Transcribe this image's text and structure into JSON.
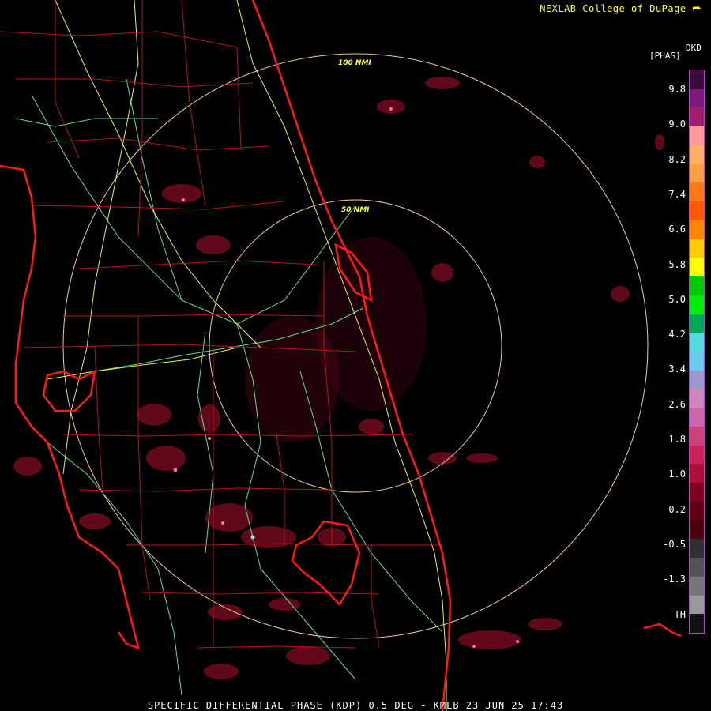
{
  "header": {
    "credit": "NEXLAB-College of DuPage"
  },
  "footer": {
    "caption": "SPECIFIC DIFFERENTIAL PHASE (KDP) 0.5 DEG - KMLB 23 JUN 25 17:43"
  },
  "map": {
    "ring_inner_label": "50 NMI",
    "ring_outer_label": "100 NMI"
  },
  "legend": {
    "unit_top": "DKD",
    "unit_sub": "[PHAS]",
    "ticks": [
      "9.8",
      "9.0",
      "8.2",
      "7.4",
      "6.6",
      "5.8",
      "5.0",
      "4.2",
      "3.4",
      "2.6",
      "1.8",
      "1.0",
      "0.2",
      "-0.5",
      "-1.3",
      "TH"
    ],
    "colors": [
      "#3a0a3a",
      "#7a1a7a",
      "#a0206e",
      "#ff9a9a",
      "#ffb060",
      "#ffa040",
      "#ff7a10",
      "#ff5a00",
      "#ff8800",
      "#ffcc00",
      "#ffff00",
      "#00cc00",
      "#00ee00",
      "#00aa55",
      "#55dddd",
      "#66ccee",
      "#9999cc",
      "#cc88bb",
      "#cc66aa",
      "#cc4477",
      "#cc2255",
      "#aa1133",
      "#800020",
      "#600010",
      "#4a0008",
      "#303030",
      "#555555",
      "#777777",
      "#999999",
      "#111111"
    ]
  },
  "icons": {
    "logo": "nexlab-corner-icon"
  }
}
